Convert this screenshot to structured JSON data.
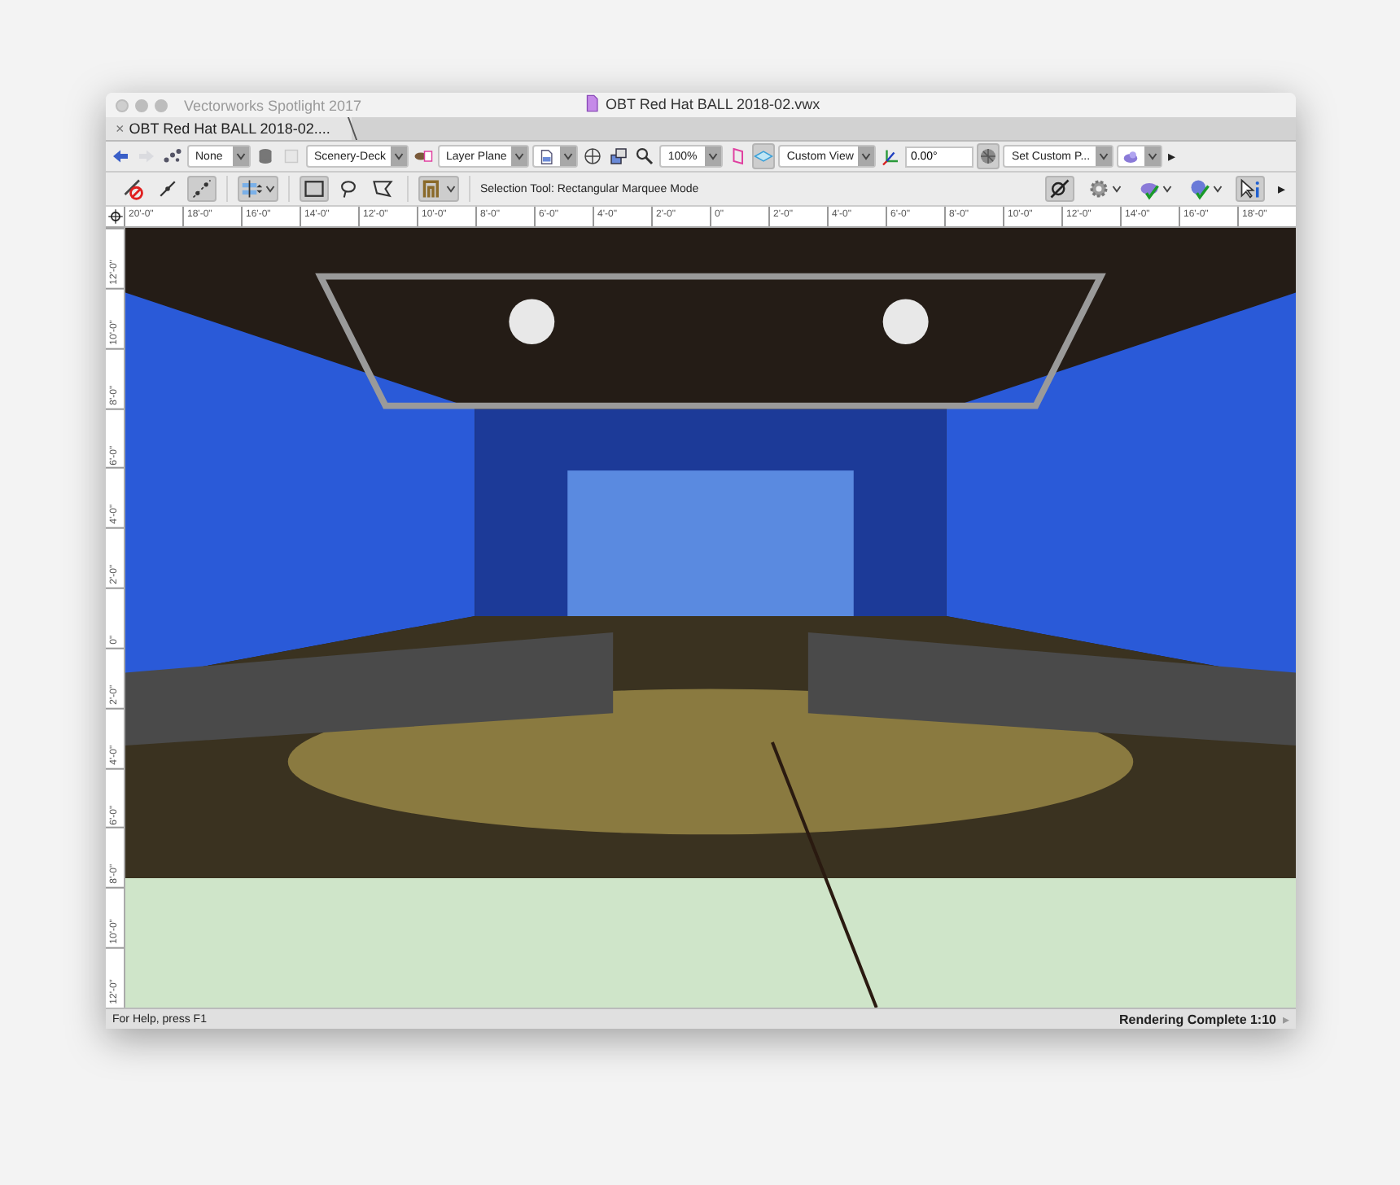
{
  "window": {
    "app_title": "Vectorworks Spotlight 2017",
    "title": "OBT Red Hat BALL 2018-02.vwx"
  },
  "tabs": [
    {
      "label": "OBT Red Hat BALL 2018-02....",
      "close": "×",
      "selected": true
    }
  ],
  "view_bar": [
    {
      "kind": "tool",
      "pressed": false,
      "disabled": false
    },
    {
      "kind": "tool",
      "pressed": false,
      "disabled": true
    },
    {
      "kind": "tool",
      "pressed": false,
      "disabled": false
    },
    {
      "kind": "dropdown",
      "value": "None"
    },
    {
      "kind": "tool",
      "pressed": false,
      "disabled": false
    },
    {
      "kind": "tool",
      "pressed": false,
      "disabled": true
    },
    {
      "kind": "dropdown",
      "value": "Scenery-Deck"
    },
    {
      "kind": "tool",
      "pressed": false,
      "disabled": false
    },
    {
      "kind": "dropdown",
      "value": "Layer Plane"
    },
    {
      "kind": "icon_dropdown"
    },
    {
      "kind": "tool",
      "pressed": false,
      "disabled": false
    },
    {
      "kind": "tool",
      "pressed": false,
      "disabled": false
    },
    {
      "kind": "tool",
      "pressed": false,
      "disabled": false
    },
    {
      "kind": "dropdown",
      "value": "100%"
    },
    {
      "kind": "tool",
      "pressed": false,
      "disabled": false
    },
    {
      "kind": "tool",
      "pressed": true,
      "disabled": false
    },
    {
      "kind": "dropdown",
      "value": "Custom View"
    },
    {
      "kind": "tool",
      "pressed": false,
      "disabled": false
    },
    {
      "kind": "field",
      "value": "0.00°"
    },
    {
      "kind": "tool",
      "pressed": true,
      "disabled": false
    },
    {
      "kind": "dropdown",
      "value": "Set Custom P..."
    },
    {
      "kind": "icon_dropdown"
    },
    {
      "kind": "more",
      "label": "▸"
    }
  ],
  "mode_bar": {
    "left_groups": [
      [
        {
          "kind": "tool",
          "pressed": false
        },
        {
          "kind": "tool",
          "pressed": false
        },
        {
          "kind": "tool",
          "pressed": true
        }
      ],
      [
        {
          "kind": "tool_menu",
          "pressed": true
        }
      ],
      [
        {
          "kind": "tool",
          "pressed": true
        },
        {
          "kind": "tool",
          "pressed": false
        },
        {
          "kind": "tool",
          "pressed": false
        }
      ],
      [
        {
          "kind": "tool_menu",
          "pressed": true
        }
      ]
    ],
    "message": "Selection Tool: Rectangular Marquee Mode",
    "right": [
      {
        "kind": "tool",
        "pressed": true
      },
      {
        "kind": "tool_menu",
        "pressed": false
      },
      {
        "kind": "tool_menu",
        "pressed": false
      },
      {
        "kind": "tool_menu",
        "pressed": false
      },
      {
        "kind": "tool",
        "pressed": true
      },
      {
        "kind": "more",
        "label": "▸"
      }
    ]
  },
  "top_ruler": {
    "labels": [
      "20'-0\"",
      "18'-0\"",
      "16'-0\"",
      "14'-0\"",
      "12'-0\"",
      "10'-0\"",
      "8'-0\"",
      "6'-0\"",
      "4'-0\"",
      "2'-0\"",
      "0\"",
      "2'-0\"",
      "4'-0\"",
      "6'-0\"",
      "8'-0\"",
      "10'-0\"",
      "12'-0\"",
      "14'-0\"",
      "16'-0\"",
      "18'-0\""
    ]
  },
  "left_ruler": {
    "labels": [
      "12'-0\"",
      "10'-0\"",
      "8'-0\"",
      "6'-0\"",
      "4'-0\"",
      "2'-0\"",
      "0\"",
      "2'-0\"",
      "4'-0\"",
      "6'-0\"",
      "8'-0\"",
      "10'-0\"",
      "12'-0\""
    ]
  },
  "status_bar": {
    "help": "For Help, press F1",
    "render_status": "Rendering Complete 1:10",
    "arrow": "▸"
  }
}
